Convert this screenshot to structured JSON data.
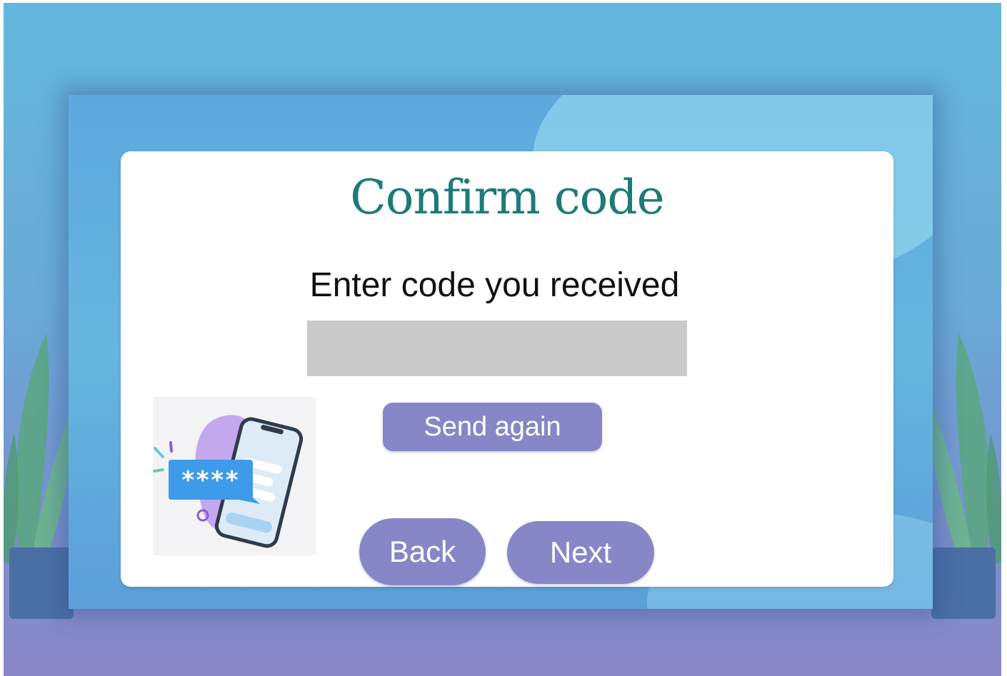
{
  "dialog": {
    "title": "Confirm code",
    "subtitle": "Enter code you received",
    "code_input": {
      "value": "",
      "placeholder": ""
    },
    "send_again_label": "Send again",
    "back_label": "Back",
    "next_label": "Next",
    "illustration": {
      "icon": "phone-code-icon",
      "masked_code": "****"
    }
  },
  "colors": {
    "title": "#1d7a7a",
    "button": "#8787c7",
    "input_bg": "#c9c9c9",
    "code_bubble": "#3d9be9",
    "blob": "#c4a8ee"
  }
}
